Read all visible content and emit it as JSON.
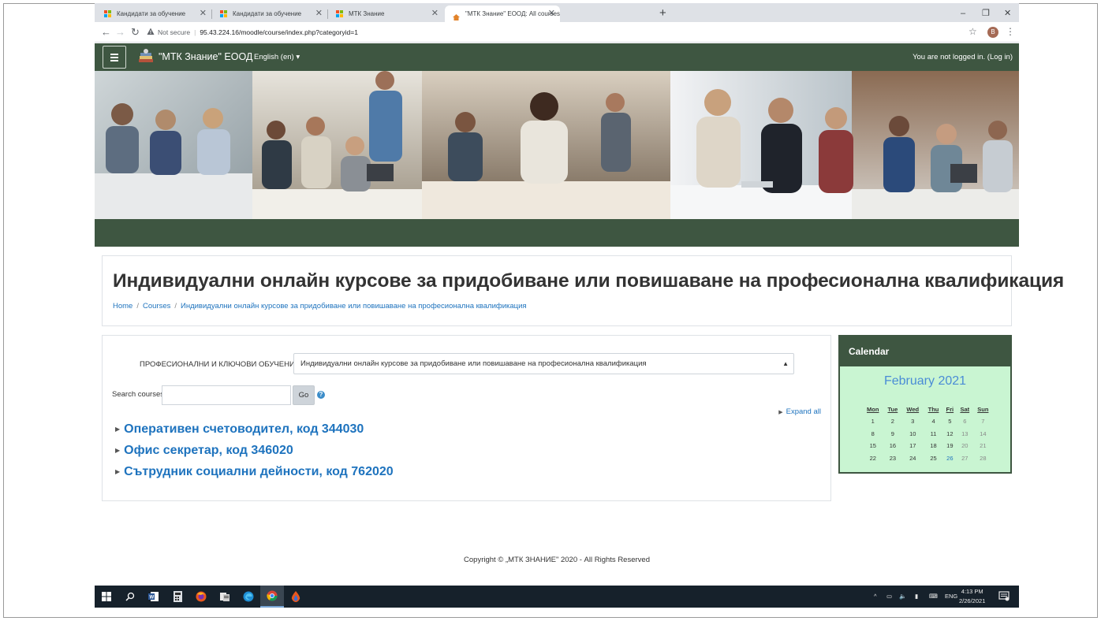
{
  "browser": {
    "tabs": [
      {
        "title": "Кандидати за обучение",
        "active": false
      },
      {
        "title": "Кандидати за обучение",
        "active": false
      },
      {
        "title": "МТК Знание",
        "active": false
      },
      {
        "title": "\"МТК Знание\" ЕООД: All courses",
        "active": true
      }
    ],
    "new_tab": "+",
    "window_controls": {
      "minimize": "–",
      "restore": "❐",
      "close": "✕"
    },
    "security_label": "Not secure",
    "url": "95.43.224.16/moodle/course/index.php?categoryid=1",
    "profile_initial": "B"
  },
  "navbar": {
    "brand": "\"МТК Знание\" ЕООД",
    "language": "English (en) ▾",
    "login_text": "You are not logged in. (Log in)"
  },
  "page": {
    "title": "Индивидуални онлайн курсове за придобиване или повишаване на професионална квалификация",
    "breadcrumb": [
      "Home",
      "Courses",
      "Индивидуални онлайн курсове за придобиване или повишаване на професионална квалификация"
    ]
  },
  "main": {
    "category_label": "ПРОФЕСИОНАЛНИ И КЛЮЧОВИ ОБУЧЕНИЯ:",
    "category_selected": "Индивидуални онлайн курсове за придобиване или повишаване на професионална квалификация",
    "search_label": "Search courses",
    "search_value": "",
    "go_label": "Go",
    "help": "?",
    "expand_all": "Expand all",
    "courses": [
      "Оперативен счетоводител, код 344030",
      "Офис секретар, код 346020",
      "Сътрудник социални дейности, код 762020"
    ]
  },
  "calendar": {
    "heading": "Calendar",
    "month": "February 2021",
    "weekdays": [
      "Mon",
      "Tue",
      "Wed",
      "Thu",
      "Fri",
      "Sat",
      "Sun"
    ],
    "weeks": [
      [
        "1",
        "2",
        "3",
        "4",
        "5",
        "6",
        "7"
      ],
      [
        "8",
        "9",
        "10",
        "11",
        "12",
        "13",
        "14"
      ],
      [
        "15",
        "16",
        "17",
        "18",
        "19",
        "20",
        "21"
      ],
      [
        "22",
        "23",
        "24",
        "25",
        "26",
        "27",
        "28"
      ]
    ],
    "today": "26"
  },
  "footer": "Copyright © „МТК ЗНАНИЕ\" 2020 - All Rights Reserved",
  "taskbar": {
    "apps": [
      "windows-start-icon",
      "search-icon",
      "word-icon",
      "calculator-icon",
      "firefox-icon",
      "files-icon",
      "edge-icon",
      "chrome-icon",
      "app-drop-icon"
    ],
    "language": "ENG",
    "time": "4:13 PM",
    "date": "2/26/2021"
  },
  "colors": {
    "brand_green": "#3e5641",
    "link_blue": "#1e73be",
    "calendar_bg": "#c9f5d2",
    "taskbar": "#16212b"
  }
}
